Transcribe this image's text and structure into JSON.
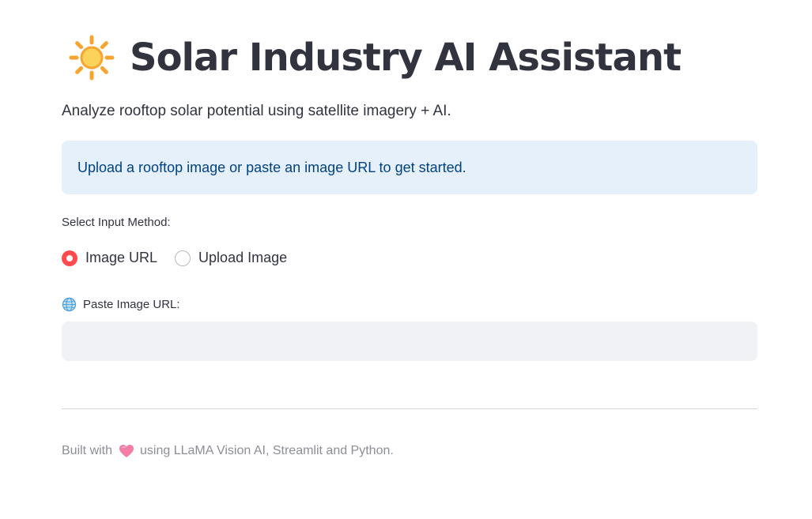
{
  "header": {
    "icon": "sun-icon",
    "title": "Solar Industry AI Assistant",
    "subtitle": "Analyze rooftop solar potential using satellite imagery + AI."
  },
  "info": {
    "text": "Upload a rooftop image or paste an image URL to get started."
  },
  "input_method": {
    "label": "Select Input Method:",
    "options": [
      {
        "label": "Image URL",
        "selected": true
      },
      {
        "label": "Upload Image",
        "selected": false
      }
    ]
  },
  "url_field": {
    "icon": "globe-icon",
    "label": "Paste Image URL:",
    "value": "",
    "placeholder": ""
  },
  "footer": {
    "prefix": "Built with",
    "icon": "heart-icon",
    "suffix": "using LLaMA Vision AI, Streamlit and Python."
  },
  "colors": {
    "accent": "#ff4b4b",
    "info_bg": "#e6f0fb",
    "info_text": "#004280",
    "input_bg": "#f0f2f6",
    "text": "#31333f",
    "muted": "#8c8e96"
  }
}
